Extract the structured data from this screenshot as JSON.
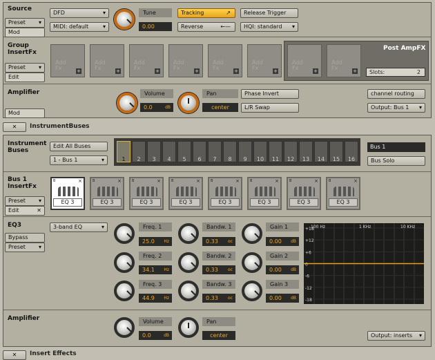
{
  "source": {
    "title": "Source",
    "preset": "Preset",
    "mod": "Mod",
    "mode": "DFD",
    "midi": "MIDI: default",
    "tune_label": "Tune",
    "tune_value": "0.00",
    "tracking": "Tracking",
    "reverse": "Reverse",
    "release_trigger": "Release Trigger",
    "hqi": "HQI: standard"
  },
  "group_fx": {
    "title": "Group\nInsertFx",
    "preset": "Preset",
    "edit": "Edit",
    "slot_label": "Add\nFx",
    "post_amp_title": "Post AmpFX",
    "slots_label": "Slots:",
    "slots_value": "2"
  },
  "amplifier": {
    "title": "Amplifier",
    "mod": "Mod",
    "volume_label": "Volume",
    "volume_value": "0.0",
    "volume_unit": "dB",
    "pan_label": "Pan",
    "pan_value": "center",
    "phase_invert": "Phase Invert",
    "lr_swap": "L/R Swap",
    "channel_routing": "channel routing",
    "output": "Output: Bus 1"
  },
  "buses_header": {
    "toggle": "✕",
    "title": "InstrumentBuses"
  },
  "buses": {
    "title": "Instrument\nBuses",
    "edit_all": "Edit All Buses",
    "select": "1 - Bus 1",
    "numbers": [
      "1",
      "2",
      "3",
      "4",
      "5",
      "6",
      "7",
      "8",
      "9",
      "10",
      "11",
      "12",
      "13",
      "14",
      "15",
      "16"
    ],
    "bus_name": "Bus 1",
    "bus_solo": "Bus Solo"
  },
  "bus_fx": {
    "title": "Bus 1\nInsertFx",
    "preset": "Preset",
    "edit": "Edit",
    "close": "✕",
    "slots": [
      "EQ 3",
      "EQ 3",
      "EQ 3",
      "EQ 3",
      "EQ 3",
      "EQ 3",
      "EQ 3",
      "EQ 3"
    ]
  },
  "eq3": {
    "title": "EQ3",
    "bypass": "Bypass",
    "preset": "Preset",
    "type": "3-band EQ",
    "freq": [
      {
        "label": "Freq. 1",
        "value": "25.0",
        "unit": "Hz"
      },
      {
        "label": "Freq. 2",
        "value": "34.1",
        "unit": "Hz"
      },
      {
        "label": "Freq. 3",
        "value": "44.9",
        "unit": "Hz"
      }
    ],
    "bandw": [
      {
        "label": "Bandw. 1",
        "value": "0.33",
        "unit": "oc"
      },
      {
        "label": "Bandw. 2",
        "value": "0.33",
        "unit": "oc"
      },
      {
        "label": "Bandw. 3",
        "value": "0.33",
        "unit": "oc"
      }
    ],
    "gain": [
      {
        "label": "Gain 1",
        "value": "0.00",
        "unit": "dB"
      },
      {
        "label": "Gain 2",
        "value": "0.00",
        "unit": "dB"
      },
      {
        "label": "Gain 3",
        "value": "0.00",
        "unit": "dB"
      }
    ],
    "graph": {
      "freq_labels": [
        "100 Hz",
        "1 KHz",
        "10 KHz"
      ],
      "db_labels": [
        "+18",
        "+12",
        "+6",
        "0",
        "-6",
        "-12",
        "-18"
      ],
      "curve_color": "#e8a020"
    }
  },
  "bus_amp": {
    "title": "Amplifier",
    "volume_label": "Volume",
    "volume_value": "0.0",
    "volume_unit": "dB",
    "pan_label": "Pan",
    "pan_value": "center",
    "output": "Output: inserts"
  },
  "footer": {
    "toggle": "✕",
    "title": "Insert Effects"
  }
}
